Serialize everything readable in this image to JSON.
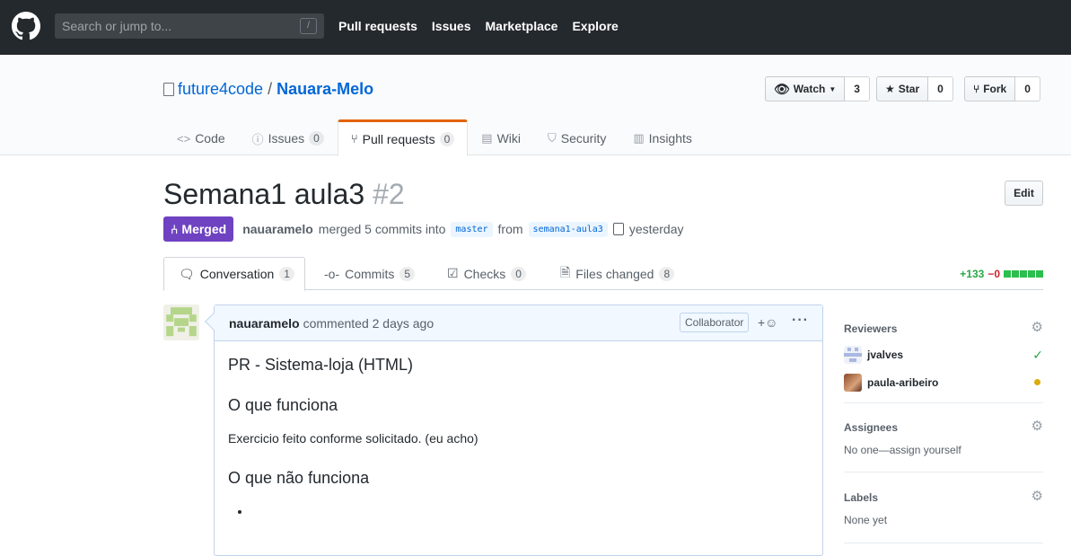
{
  "header": {
    "search_placeholder": "Search or jump to...",
    "slash_key": "/",
    "nav": [
      "Pull requests",
      "Issues",
      "Marketplace",
      "Explore"
    ]
  },
  "repo": {
    "owner": "future4code",
    "separator": "/",
    "name": "Nauara-Melo",
    "watch_label": "Watch",
    "watch_count": "3",
    "star_label": "Star",
    "star_count": "0",
    "fork_label": "Fork",
    "fork_count": "0"
  },
  "repo_tabs": [
    {
      "label": "Code",
      "icon": "<>",
      "counter": ""
    },
    {
      "label": "Issues",
      "icon": "ⓘ",
      "counter": "0"
    },
    {
      "label": "Pull requests",
      "icon": "⑂",
      "counter": "0"
    },
    {
      "label": "Wiki",
      "icon": "▤",
      "counter": ""
    },
    {
      "label": "Security",
      "icon": "⛉",
      "counter": ""
    },
    {
      "label": "Insights",
      "icon": "▥",
      "counter": ""
    }
  ],
  "pr": {
    "title": "Semana1 aula3",
    "number": "#2",
    "edit_label": "Edit",
    "state": "Merged",
    "author": "nauaramelo",
    "merged_text": "merged 5 commits into",
    "base_branch": "master",
    "from_text": "from",
    "head_branch": "semana1-aula3",
    "time": "yesterday"
  },
  "pr_tabs": [
    {
      "label": "Conversation",
      "counter": "1"
    },
    {
      "label": "Commits",
      "counter": "5"
    },
    {
      "label": "Checks",
      "counter": "0"
    },
    {
      "label": "Files changed",
      "counter": "8"
    }
  ],
  "diffstat": {
    "additions": "+133",
    "deletions": "−0"
  },
  "comment": {
    "author": "nauaramelo",
    "action": "commented 2 days ago",
    "role": "Collaborator",
    "h1": "PR - Sistema-loja (HTML)",
    "h2": "O que funciona",
    "p1": "Exercicio feito conforme solicitado. (eu acho)",
    "h3": "O que não funciona",
    "bullet": ""
  },
  "sidebar": {
    "reviewers_title": "Reviewers",
    "reviewers": [
      {
        "name": "jvalves",
        "status": "approved"
      },
      {
        "name": "paula-aribeiro",
        "status": "pending"
      }
    ],
    "assignees_title": "Assignees",
    "assignees_text": "No one—assign yourself",
    "labels_title": "Labels",
    "labels_text": "None yet"
  },
  "colors": {
    "merged": "#6f42c1",
    "link": "#0366d6",
    "approved": "#28a745",
    "pending": "#dbab09"
  }
}
